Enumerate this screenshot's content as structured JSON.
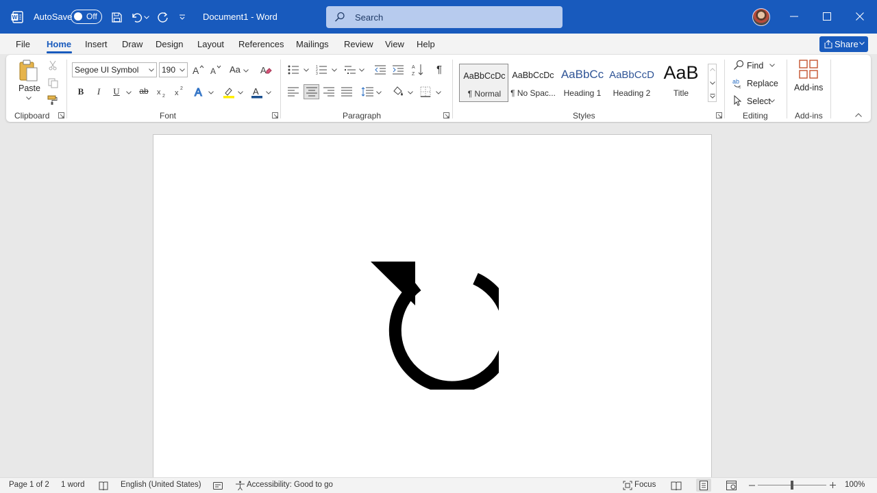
{
  "titlebar": {
    "autosave_label": "AutoSave",
    "autosave_state": "Off",
    "document_title": "Document1  -  Word",
    "search_placeholder": "Search"
  },
  "menu": {
    "tabs": [
      "File",
      "Home",
      "Insert",
      "Draw",
      "Design",
      "Layout",
      "References",
      "Mailings",
      "Review",
      "View",
      "Help"
    ],
    "active": "Home",
    "share_label": "Share"
  },
  "ribbon": {
    "clipboard": {
      "paste_label": "Paste",
      "group_label": "Clipboard"
    },
    "font": {
      "font_name": "Segoe UI Symbol",
      "font_size": "190",
      "group_label": "Font",
      "change_case": "Aa"
    },
    "paragraph": {
      "group_label": "Paragraph"
    },
    "styles": {
      "group_label": "Styles",
      "items": [
        {
          "preview": "AaBbCcDc",
          "name": "¶ Normal"
        },
        {
          "preview": "AaBbCcDc",
          "name": "¶ No Spac..."
        },
        {
          "preview": "AaBbCc",
          "name": "Heading 1"
        },
        {
          "preview": "AaBbCcD",
          "name": "Heading 2"
        },
        {
          "preview": "AaB",
          "name": "Title"
        }
      ]
    },
    "editing": {
      "find": "Find",
      "replace": "Replace",
      "select": "Select",
      "group_label": "Editing"
    },
    "addins": {
      "label": "Add-ins",
      "group_label": "Add-ins"
    }
  },
  "document": {
    "content_glyph": "clockwise-open-circle-arrow"
  },
  "statusbar": {
    "page": "Page 1 of 2",
    "words": "1 word",
    "language": "English (United States)",
    "accessibility": "Accessibility: Good to go",
    "focus": "Focus",
    "zoom": "100%"
  },
  "colors": {
    "brand": "#185abd",
    "ribbon_bg": "#ffffff",
    "canvas_bg": "#e8e8e8"
  }
}
